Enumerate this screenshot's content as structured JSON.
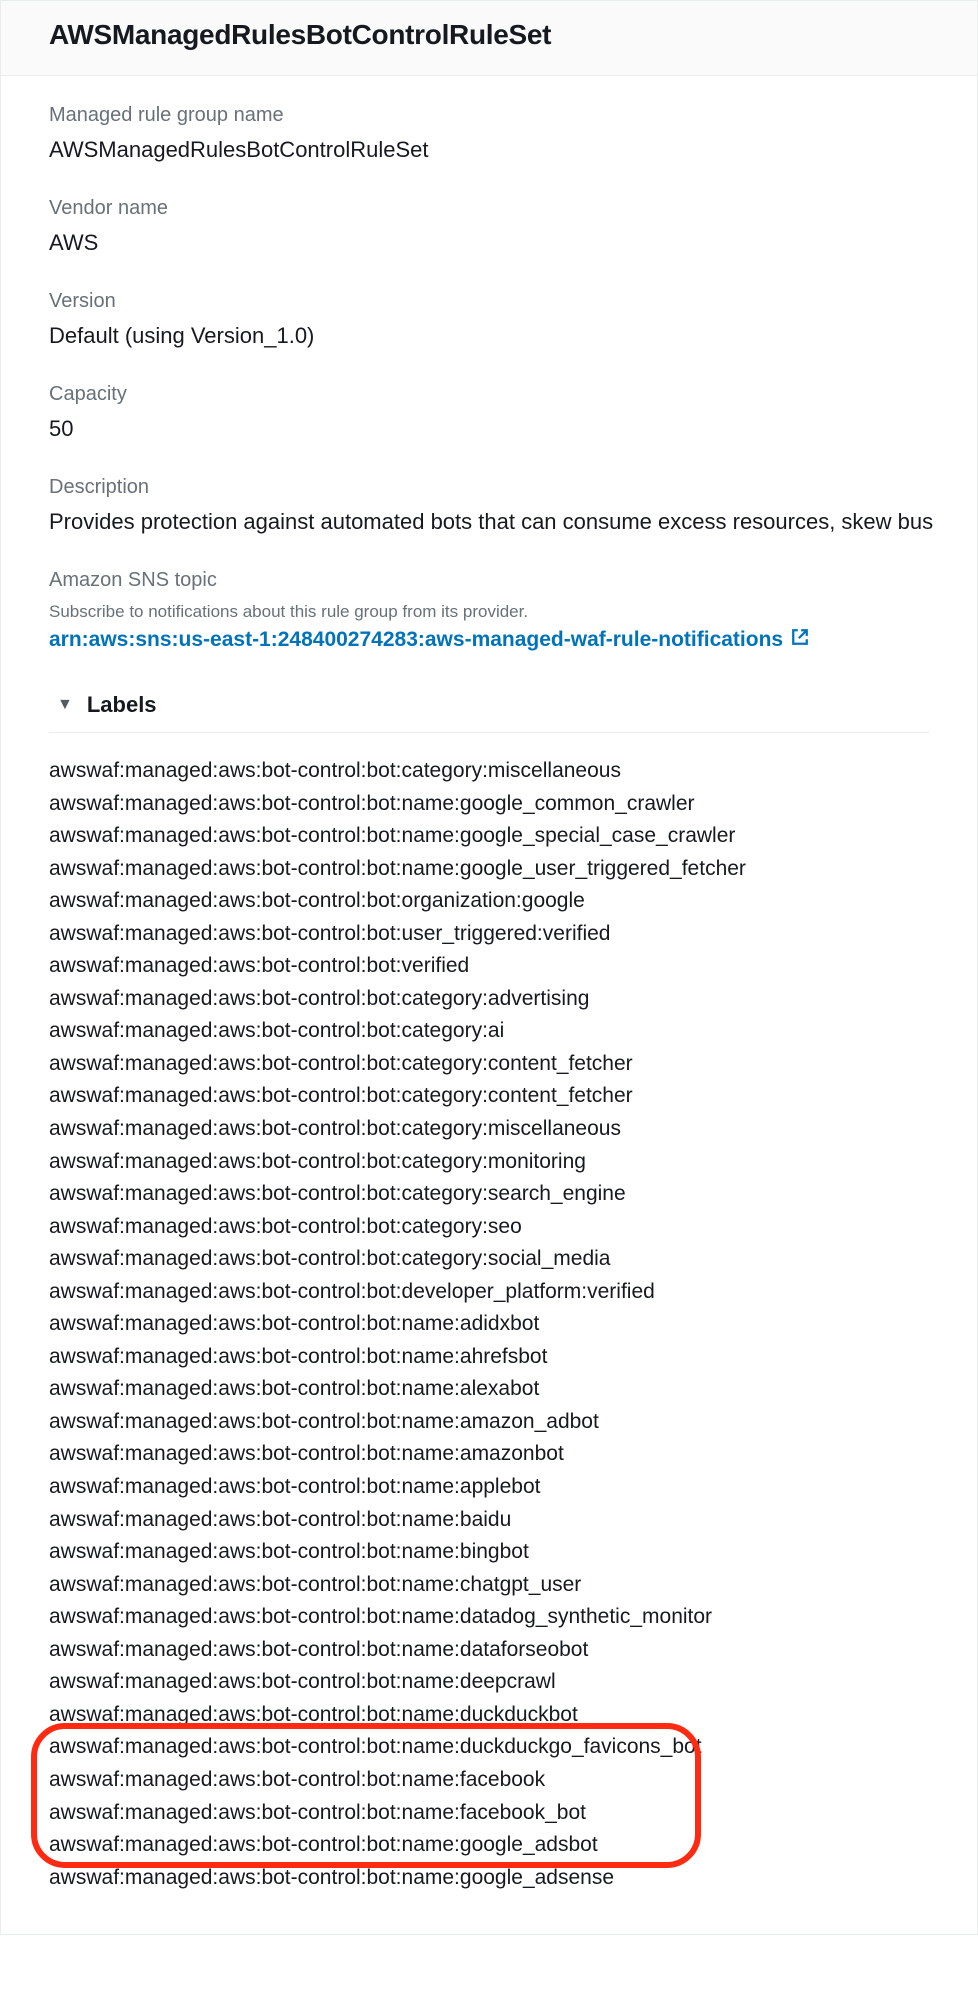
{
  "header": {
    "title": "AWSManagedRulesBotControlRuleSet"
  },
  "fields": {
    "ruleGroupName": {
      "label": "Managed rule group name",
      "value": "AWSManagedRulesBotControlRuleSet"
    },
    "vendorName": {
      "label": "Vendor name",
      "value": "AWS"
    },
    "version": {
      "label": "Version",
      "value": "Default (using Version_1.0)"
    },
    "capacity": {
      "label": "Capacity",
      "value": "50"
    },
    "description": {
      "label": "Description",
      "value": "Provides protection against automated bots that can consume excess resources, skew bus"
    },
    "snsTopic": {
      "label": "Amazon SNS topic",
      "helper": "Subscribe to notifications about this rule group from its provider.",
      "link": "arn:aws:sns:us-east-1:248400274283:aws-managed-waf-rule-notifications"
    }
  },
  "labelsSection": {
    "title": "Labels",
    "items": [
      "awswaf:managed:aws:bot-control:bot:category:miscellaneous",
      "awswaf:managed:aws:bot-control:bot:name:google_common_crawler",
      "awswaf:managed:aws:bot-control:bot:name:google_special_case_crawler",
      "awswaf:managed:aws:bot-control:bot:name:google_user_triggered_fetcher",
      "awswaf:managed:aws:bot-control:bot:organization:google",
      "awswaf:managed:aws:bot-control:bot:user_triggered:verified",
      "awswaf:managed:aws:bot-control:bot:verified",
      "awswaf:managed:aws:bot-control:bot:category:advertising",
      "awswaf:managed:aws:bot-control:bot:category:ai",
      "awswaf:managed:aws:bot-control:bot:category:content_fetcher",
      "awswaf:managed:aws:bot-control:bot:category:content_fetcher",
      "awswaf:managed:aws:bot-control:bot:category:miscellaneous",
      "awswaf:managed:aws:bot-control:bot:category:monitoring",
      "awswaf:managed:aws:bot-control:bot:category:search_engine",
      "awswaf:managed:aws:bot-control:bot:category:seo",
      "awswaf:managed:aws:bot-control:bot:category:social_media",
      "awswaf:managed:aws:bot-control:bot:developer_platform:verified",
      "awswaf:managed:aws:bot-control:bot:name:adidxbot",
      "awswaf:managed:aws:bot-control:bot:name:ahrefsbot",
      "awswaf:managed:aws:bot-control:bot:name:alexabot",
      "awswaf:managed:aws:bot-control:bot:name:amazon_adbot",
      "awswaf:managed:aws:bot-control:bot:name:amazonbot",
      "awswaf:managed:aws:bot-control:bot:name:applebot",
      "awswaf:managed:aws:bot-control:bot:name:baidu",
      "awswaf:managed:aws:bot-control:bot:name:bingbot",
      "awswaf:managed:aws:bot-control:bot:name:chatgpt_user",
      "awswaf:managed:aws:bot-control:bot:name:datadog_synthetic_monitor",
      "awswaf:managed:aws:bot-control:bot:name:dataforseobot",
      "awswaf:managed:aws:bot-control:bot:name:deepcrawl",
      "awswaf:managed:aws:bot-control:bot:name:duckduckbot",
      "awswaf:managed:aws:bot-control:bot:name:duckduckgo_favicons_bot",
      "awswaf:managed:aws:bot-control:bot:name:facebook",
      "awswaf:managed:aws:bot-control:bot:name:facebook_bot",
      "awswaf:managed:aws:bot-control:bot:name:google_adsbot",
      "awswaf:managed:aws:bot-control:bot:name:google_adsense"
    ],
    "highlightStartIndex": 30,
    "highlightEndIndex": 33
  }
}
